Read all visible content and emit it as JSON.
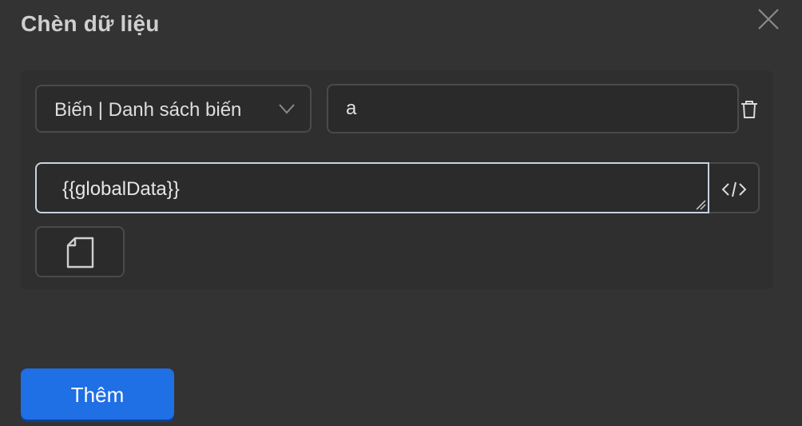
{
  "dialog": {
    "title": "Chèn dữ liệu",
    "close_icon": "close-icon"
  },
  "row": {
    "select_value": "Biến | Danh sách biến",
    "select_icon": "chevron-down-icon",
    "name_value": "a",
    "delete_icon": "trash-icon"
  },
  "value_field": {
    "text": "{{globalData}}",
    "code_icon": "code-icon"
  },
  "doc_button": {
    "icon": "document-icon"
  },
  "footer": {
    "add_label": "Thêm"
  },
  "colors": {
    "background": "#333333",
    "accent": "#1f6fe5"
  }
}
